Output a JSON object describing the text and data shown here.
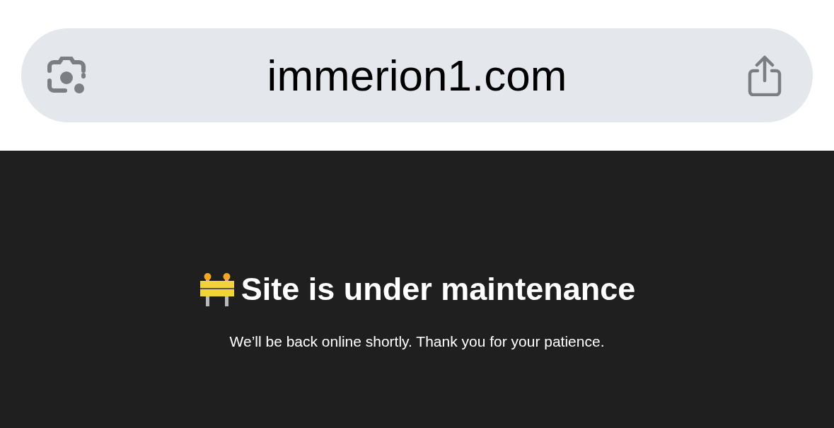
{
  "address_bar": {
    "url": "immerion1.com"
  },
  "page": {
    "heading": "Site is under maintenance",
    "message": "We’ll be back online shortly. Thank you for your patience."
  }
}
